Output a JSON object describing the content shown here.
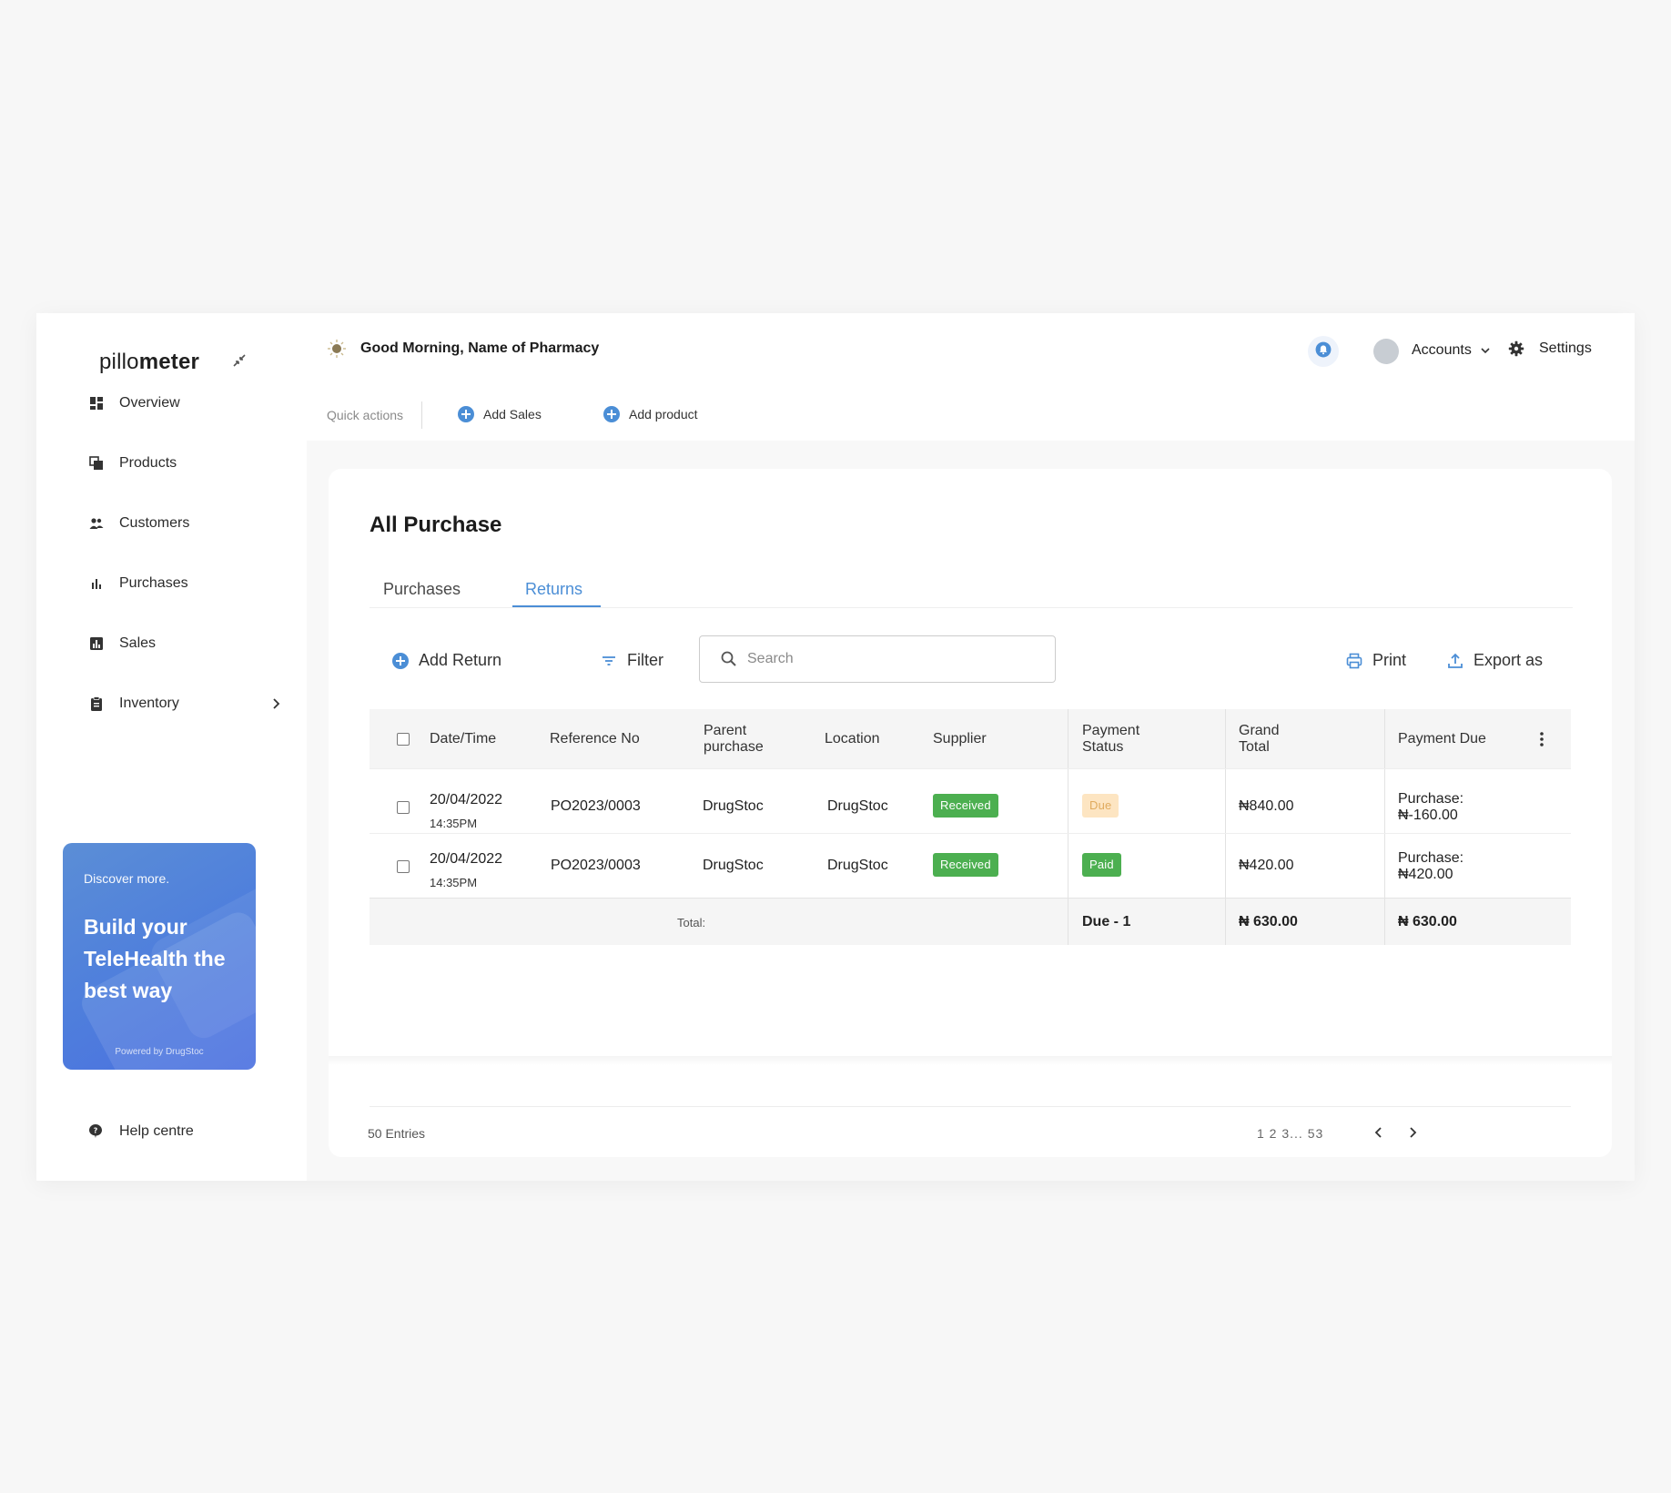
{
  "sidebar": {
    "logo_light": "pillo",
    "logo_bold": "meter",
    "items": [
      {
        "label": "Overview",
        "icon": "dashboard-icon"
      },
      {
        "label": "Products",
        "icon": "products-icon"
      },
      {
        "label": "Customers",
        "icon": "customers-icon"
      },
      {
        "label": "Purchases",
        "icon": "bar-chart-icon"
      },
      {
        "label": "Sales",
        "icon": "sales-chart-icon"
      },
      {
        "label": "Inventory",
        "icon": "clipboard-icon"
      }
    ],
    "promo": {
      "discover": "Discover more.",
      "headline": "Build your TeleHealth the best way",
      "powered": "Powered by DrugStoc"
    },
    "help": "Help centre"
  },
  "header": {
    "greeting": "Good Morning, Name of Pharmacy",
    "accounts": "Accounts",
    "settings": "Settings",
    "quick_actions": "Quick actions",
    "add_sales": "Add Sales",
    "add_product": "Add product"
  },
  "page": {
    "title": "All Purchase",
    "tabs": [
      "Purchases",
      "Returns"
    ],
    "active_tab": "Returns",
    "add_return": "Add Return",
    "filter": "Filter",
    "search_placeholder": "Search",
    "print": "Print",
    "export": "Export as"
  },
  "table": {
    "columns": {
      "date": "Date/Time",
      "ref": "Reference No",
      "parent_1": "Parent",
      "parent_2": "purchase",
      "location": "Location",
      "supplier": "Supplier",
      "pay_status_1": "Payment",
      "pay_status_2": "Status",
      "grand_1": "Grand",
      "grand_2": "Total",
      "pay_due": "Payment Due"
    },
    "rows": [
      {
        "date": "20/04/2022",
        "time": "14:35PM",
        "ref": "PO2023/0003",
        "parent": "DrugStoc",
        "location": "DrugStoc",
        "supplier_status": "Received",
        "payment_status": "Due",
        "grand_total": "₦840.00",
        "due_label": "Purchase:",
        "due_value": "₦-160.00"
      },
      {
        "date": "20/04/2022",
        "time": "14:35PM",
        "ref": "PO2023/0003",
        "parent": "DrugStoc",
        "location": "DrugStoc",
        "supplier_status": "Received",
        "payment_status": "Paid",
        "grand_total": "₦420.00",
        "due_label": "Purchase:",
        "due_value": "₦420.00"
      }
    ],
    "footer": {
      "label": "Total:",
      "status": "Due - 1",
      "grand_total": "₦ 630.00",
      "payment_due": "₦ 630.00"
    }
  },
  "pagination": {
    "entries": "50 Entries",
    "pages": "1 2 3...  53"
  },
  "colors": {
    "accent": "#4b8ed6",
    "received": "#4caf50",
    "due_bg": "#fde5c2",
    "promo": "#4f7fdc"
  }
}
